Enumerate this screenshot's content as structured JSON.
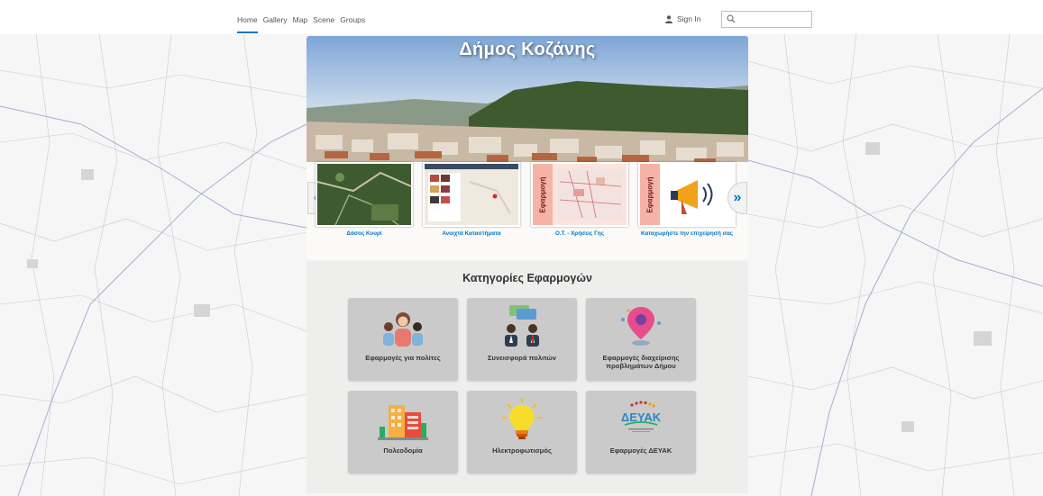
{
  "nav": {
    "links": [
      "Home",
      "Gallery",
      "Map",
      "Scene",
      "Groups"
    ],
    "active": "Home",
    "sign_in": "Sign In",
    "search_placeholder": ""
  },
  "hero": {
    "title": "Δήμος Κοζάνης"
  },
  "carousel": {
    "items": [
      {
        "label": "Δάσος Κουρί"
      },
      {
        "label": "Ανοιχτά Καταστήματα"
      },
      {
        "label": "Ο.Τ. - Χρήσεις Γης",
        "badge": "Εφαρμογή"
      },
      {
        "label": "Καταχωρήστε την επιχείρησή σας",
        "badge": "Εφαρμογή"
      }
    ],
    "prev": "«",
    "next": "»"
  },
  "categories": {
    "title": "Κατηγορίες Εφαρμογών",
    "tiles": [
      {
        "label": "Εφαρμογές για πολίτες",
        "icon": "citizens-icon"
      },
      {
        "label": "Συνεισφορά πολιτών",
        "icon": "chat-people-icon"
      },
      {
        "label": "Εφαρμογές διαχείρισης προβλημάτων Δήμου",
        "icon": "map-pin-icon"
      },
      {
        "label": "Πολεοδομία",
        "icon": "buildings-icon"
      },
      {
        "label": "Ηλεκτροφωτισμός",
        "icon": "light-bulb-icon"
      },
      {
        "label": "Εφαρμογές ΔΕΥΑΚ",
        "icon": "deyak-logo"
      }
    ],
    "deyak_logo_text": "ΔΕΥΑΚ"
  },
  "colors": {
    "accent": "#0079c1",
    "tile_bg": "#cacaca",
    "panel_bg": "#eeeeed",
    "badge_bg": "#f4b3a6"
  }
}
